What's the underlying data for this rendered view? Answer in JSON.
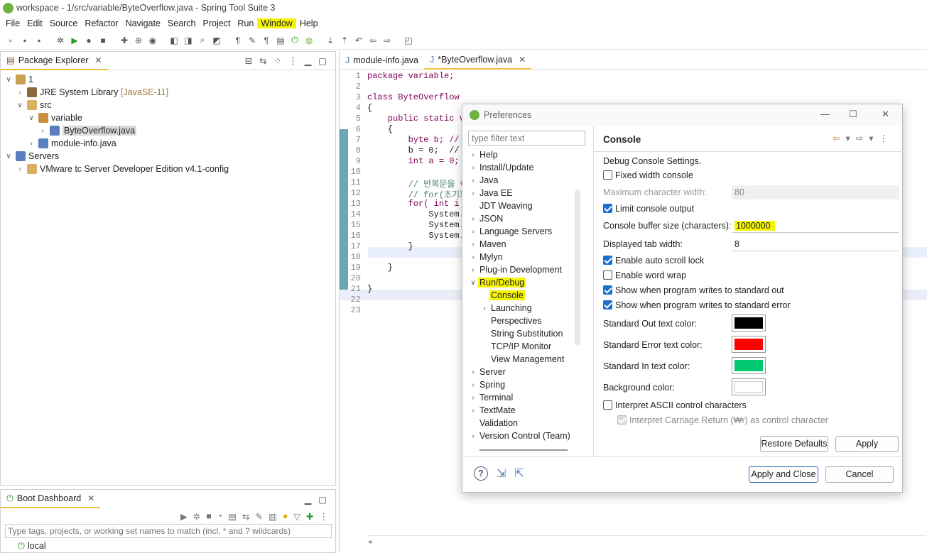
{
  "window": {
    "title": "workspace - 1/src/variable/ByteOverflow.java - Spring Tool Suite 3"
  },
  "menu": [
    "File",
    "Edit",
    "Source",
    "Refactor",
    "Navigate",
    "Search",
    "Project",
    "Run",
    "Window",
    "Help"
  ],
  "package_explorer": {
    "title": "Package Explorer",
    "tree": [
      {
        "label": "1",
        "extra": ""
      },
      {
        "label": "JRE System Library",
        "extra": "[JavaSE-11]"
      },
      {
        "label": "src",
        "extra": ""
      },
      {
        "label": "variable",
        "extra": ""
      },
      {
        "label": "ByteOverflow.java",
        "extra": ""
      },
      {
        "label": "module-info.java",
        "extra": ""
      },
      {
        "label": "Servers",
        "extra": ""
      },
      {
        "label": "VMware tc Server Developer Edition v4.1-config",
        "extra": ""
      }
    ]
  },
  "boot_dashboard": {
    "title": "Boot Dashboard",
    "filter_placeholder": "Type tags, projects, or working set names to match (incl. * and ? wildcards)",
    "item": "local"
  },
  "editor": {
    "tabs": [
      "module-info.java",
      "*ByteOverflow.java"
    ],
    "line_numbers": [
      "1",
      "2",
      "3",
      "4",
      "5",
      "6",
      "7",
      "8",
      "9",
      "10",
      "11",
      "12",
      "13",
      "14",
      "15",
      "16",
      "17",
      "18",
      "19",
      "20",
      "21",
      "22",
      "23"
    ],
    "lines": [
      "package variable;",
      "",
      "class ByteOverflow",
      "{",
      "    public static vo",
      "    {",
      "        byte b; // ",
      "        b = 0;  // ",
      "        int a = 0;",
      "",
      "        // 반복문을 이",
      "        // for(초기화",
      "        for( int i =",
      "            System.o",
      "            System.o",
      "            System.o",
      "        }",
      "",
      "    }",
      "",
      "}",
      "",
      ""
    ]
  },
  "preferences": {
    "title": "Preferences",
    "filter_placeholder": "type filter text",
    "tree": [
      "Help",
      "Install/Update",
      "Java",
      "Java EE",
      "JDT Weaving",
      "JSON",
      "Language Servers",
      "Maven",
      "Mylyn",
      "Plug-in Development",
      "Run/Debug",
      "Console",
      "Launching",
      "Perspectives",
      "String Substitution",
      "TCP/IP Monitor",
      "View Management",
      "Server",
      "Spring",
      "Terminal",
      "TextMate",
      "Validation",
      "Version Control (Team)"
    ],
    "page_title": "Console",
    "section_label": "Debug Console Settings.",
    "fixed_width": "Fixed width console",
    "max_char_width_label": "Maximum character width:",
    "max_char_width_value": "80",
    "limit_output": "Limit console output",
    "buffer_label": "Console buffer size (characters):",
    "buffer_value": "1000000",
    "tab_width_label": "Displayed tab width:",
    "tab_width_value": "8",
    "auto_scroll": "Enable auto scroll lock",
    "word_wrap": "Enable word wrap",
    "show_stdout": "Show when program writes to standard out",
    "show_stderr": "Show when program writes to standard error",
    "stdout_color_label": "Standard Out text color:",
    "stderr_color_label": "Standard Error text color:",
    "stdin_color_label": "Standard In text color:",
    "bg_color_label": "Background color:",
    "interpret_ascii": "Interpret ASCII control characters",
    "interpret_cr": "Interpret Carriage Return (₩r) as control character",
    "restore_defaults": "Restore Defaults",
    "apply": "Apply",
    "apply_close": "Apply and Close",
    "cancel": "Cancel",
    "colors": {
      "stdout": "#000000",
      "stderr": "#ff0000",
      "stdin": "#00c86e",
      "background": "#ffffff"
    }
  }
}
